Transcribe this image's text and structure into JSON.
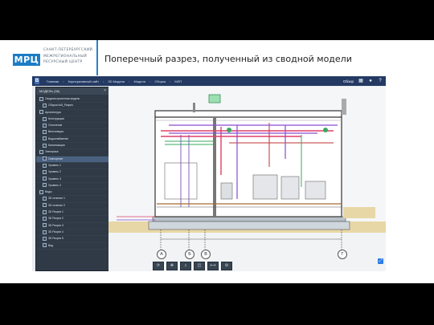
{
  "slide": {
    "logo": "МРЦ",
    "logo_text_lines": [
      "САНКТ-ПЕТЕРБУРГСКИЙ",
      "МЕЖРЕГИОНАЛЬНЫЙ",
      "РЕСУРСНЫЙ ЦЕНТР"
    ],
    "title": "Поперечный разрез, полученный из сводной модели"
  },
  "app": {
    "brand_icon": "B",
    "breadcrumbs": [
      "Главная",
      "Корпоративный сайт",
      "3D Модели",
      "Модели",
      "Сборка",
      "МЛП"
    ],
    "share_label": "Обзор",
    "top_icons": [
      "grid-icon",
      "user-icon",
      "help-icon"
    ],
    "panel_title": "МОДЕЛЬ (36)",
    "tree": [
      {
        "label": "Сводная проектная модель",
        "level": 1
      },
      {
        "label": "Сборка №5_Разрез",
        "level": 2
      },
      {
        "label": "Архитектура",
        "level": 1
      },
      {
        "label": "Конструкции",
        "level": 2
      },
      {
        "label": "Отопление",
        "level": 2
      },
      {
        "label": "Вентиляция",
        "level": 2
      },
      {
        "label": "Водоснабжение",
        "level": 2
      },
      {
        "label": "Канализация",
        "level": 2
      },
      {
        "label": "Электрика",
        "level": 1
      },
      {
        "label": "Освещение",
        "level": 2,
        "selected": true
      },
      {
        "label": "Уровень 1",
        "level": 2
      },
      {
        "label": "Уровень 2",
        "level": 2
      },
      {
        "label": "Уровень 3",
        "level": 2
      },
      {
        "label": "Уровень 4",
        "level": 2
      },
      {
        "label": "Виды",
        "level": 1
      },
      {
        "label": "3D сечение 1",
        "level": 2
      },
      {
        "label": "3D сечение 2",
        "level": 2
      },
      {
        "label": "3D Разрез 1",
        "level": 2
      },
      {
        "label": "3D Разрез 2",
        "level": 2
      },
      {
        "label": "3D Разрез 3",
        "level": 2
      },
      {
        "label": "3D Разрез 4",
        "level": 2
      },
      {
        "label": "3D Разрез 5",
        "level": 2
      },
      {
        "label": "Вид",
        "level": 2
      }
    ],
    "axes": [
      "А",
      "Б",
      "В",
      "Г"
    ],
    "toolbar_icons": [
      "orbit-icon",
      "pan-icon",
      "zoom-icon",
      "section-icon",
      "measure-icon",
      "settings-icon"
    ],
    "colors": {
      "accent": "#2c7be5",
      "topbar": "#243a63",
      "panel": "#2f3a46"
    }
  }
}
